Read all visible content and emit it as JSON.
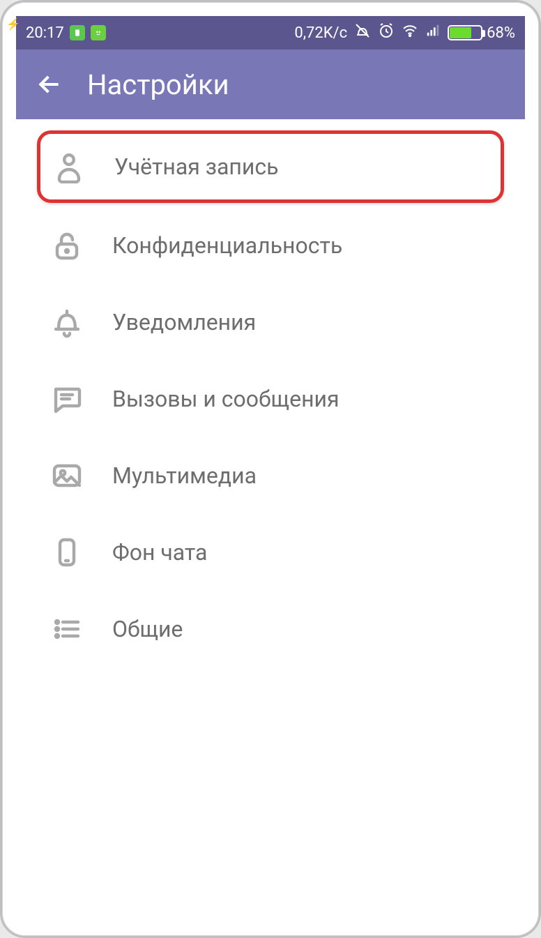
{
  "status": {
    "time": "20:17",
    "speed": "0,72K/c",
    "battery_pct": "68%"
  },
  "header": {
    "title": "Настройки"
  },
  "settings": {
    "items": [
      {
        "label": "Учётная запись"
      },
      {
        "label": "Конфиденциальность"
      },
      {
        "label": "Уведомления"
      },
      {
        "label": "Вызовы и сообщения"
      },
      {
        "label": "Мультимедиа"
      },
      {
        "label": "Фон чата"
      },
      {
        "label": "Общие"
      }
    ]
  },
  "colors": {
    "header": "#7a77b6",
    "statusbar": "#5b578e",
    "highlight_border": "#d33",
    "text_muted": "#6d6d6d",
    "icon_stroke": "#a9a9a9"
  }
}
